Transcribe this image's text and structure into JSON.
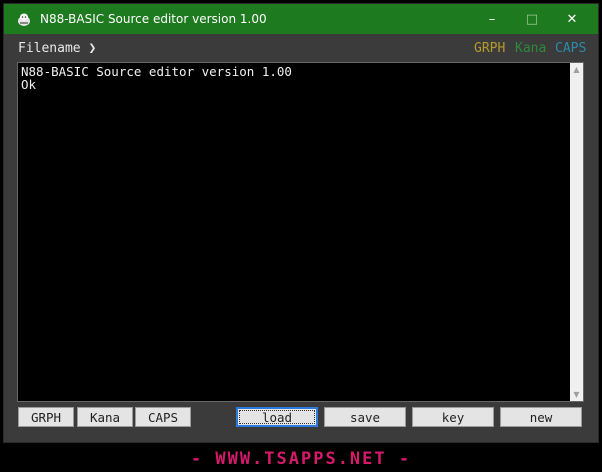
{
  "window": {
    "title": "N88-BASIC Source editor version 1.00",
    "icon": "app-icon",
    "controls": {
      "minimize": "–",
      "maximize": "□",
      "close": "✕"
    }
  },
  "status": {
    "filename_label": "Filename ❯",
    "flags": {
      "grph": "GRPH",
      "kana": "Kana",
      "caps": "CAPS"
    },
    "colors": {
      "grph": "#b59a2e",
      "kana": "#2e8a3a",
      "caps": "#2e8aa8"
    }
  },
  "editor": {
    "text": "N88-BASIC Source editor version 1.00\nOk",
    "scroll_up": "▲",
    "scroll_down": "▼"
  },
  "buttons": {
    "grph": "GRPH",
    "kana": "Kana",
    "caps": "CAPS",
    "load": "load",
    "save": "save",
    "key": "key",
    "new": "new"
  },
  "watermark": "- WWW.TSAPPS.NET -",
  "colors": {
    "titlebar": "#1e7a1e",
    "window_bg": "#3b3b3b",
    "editor_bg": "#000000",
    "editor_text": "#f0f0f0",
    "watermark": "#d51a6c"
  }
}
